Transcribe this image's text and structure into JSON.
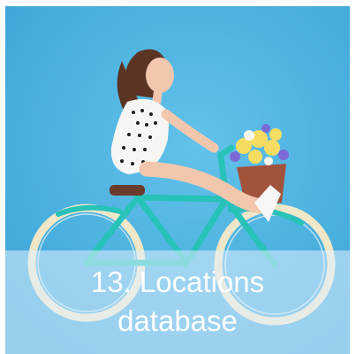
{
  "card": {
    "caption_line1": "13. Locations",
    "caption_line2": "database"
  },
  "colors": {
    "background": "#4fb3e0",
    "bike_frame": "#27c2b8",
    "tire": "#efe7c8",
    "caption_overlay": "#e1f1ff",
    "caption_text": "#ffffff"
  }
}
